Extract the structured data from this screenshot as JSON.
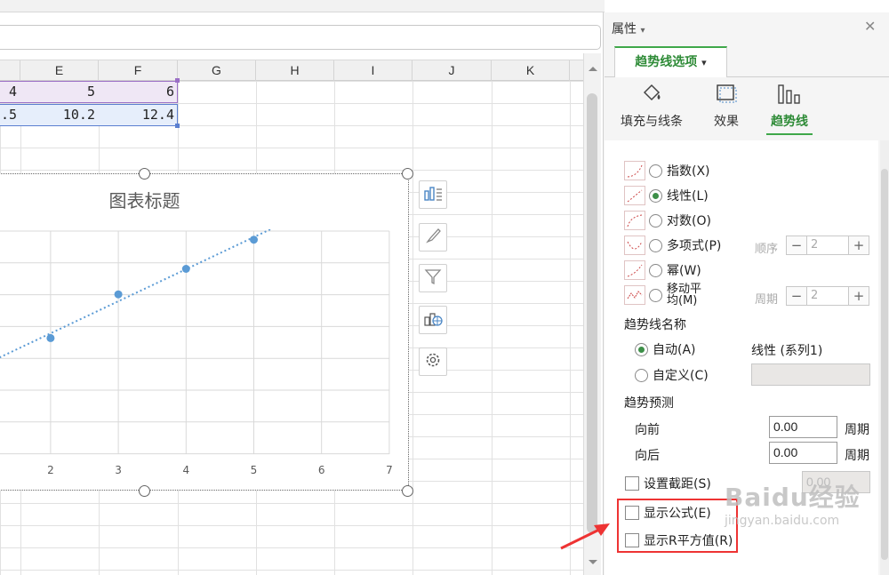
{
  "sheet": {
    "columns": [
      "E",
      "F",
      "G",
      "H",
      "I",
      "J",
      "K"
    ],
    "row1": [
      "4",
      "5",
      "6"
    ],
    "row2": [
      ".5",
      "10.2",
      "12.4"
    ]
  },
  "chart": {
    "title": "图表标题",
    "x_ticks": [
      "2",
      "3",
      "4",
      "5",
      "6",
      "7"
    ]
  },
  "chart_data": {
    "type": "scatter",
    "title": "图表标题",
    "x": [
      2,
      3,
      4,
      5
    ],
    "y": [
      2.2,
      3.4,
      4.1,
      4.9
    ],
    "trendline": {
      "type": "linear",
      "x_range": [
        0,
        6
      ]
    },
    "xlim": [
      0,
      7
    ],
    "grid": true,
    "colors": {
      "points": "#5b9bd5"
    }
  },
  "floating_toolbar": [
    "chart-elements-icon",
    "chart-style-icon",
    "chart-filter-icon",
    "chart-type-icon",
    "settings-icon"
  ],
  "panel": {
    "title": "属性",
    "dropdown_glyph": "▾",
    "close_glyph": "✕",
    "main_tab": "趋势线选项",
    "subtabs": [
      {
        "label": "填充与线条",
        "icon": "fill-bucket-icon"
      },
      {
        "label": "效果",
        "icon": "effect-icon"
      },
      {
        "label": "趋势线",
        "icon": "trendline-bars-icon"
      }
    ],
    "trend_types": [
      {
        "label": "指数(X)",
        "selected": false
      },
      {
        "label": "线性(L)",
        "selected": true
      },
      {
        "label": "对数(O)",
        "selected": false
      },
      {
        "label": "多项式(P)",
        "selected": false
      },
      {
        "label": "幂(W)",
        "selected": false
      },
      {
        "label": "移动平均(M)",
        "selected": false
      }
    ],
    "order_label": "顺序",
    "order_value": "2",
    "period_label": "周期",
    "period_value": "2",
    "minus": "−",
    "plus": "+",
    "name_section": "趋势线名称",
    "auto_label": "自动(A)",
    "auto_value": "线性 (系列1)",
    "custom_label": "自定义(C)",
    "forecast_section": "趋势预测",
    "forward_label": "向前",
    "forward_value": "0.00",
    "backward_label": "向后",
    "backward_value": "0.00",
    "period_unit": "周期",
    "intercept_label": "设置截距(S)",
    "intercept_value": "0.00",
    "show_equation_label": "显示公式(E)",
    "show_r2_label": "显示R平方值(R)"
  },
  "watermark": {
    "text": "Baidu经验",
    "url": "jingyan.baidu.com"
  },
  "colors": {
    "accent": "#3fa84a",
    "highlight": "#e33333"
  }
}
